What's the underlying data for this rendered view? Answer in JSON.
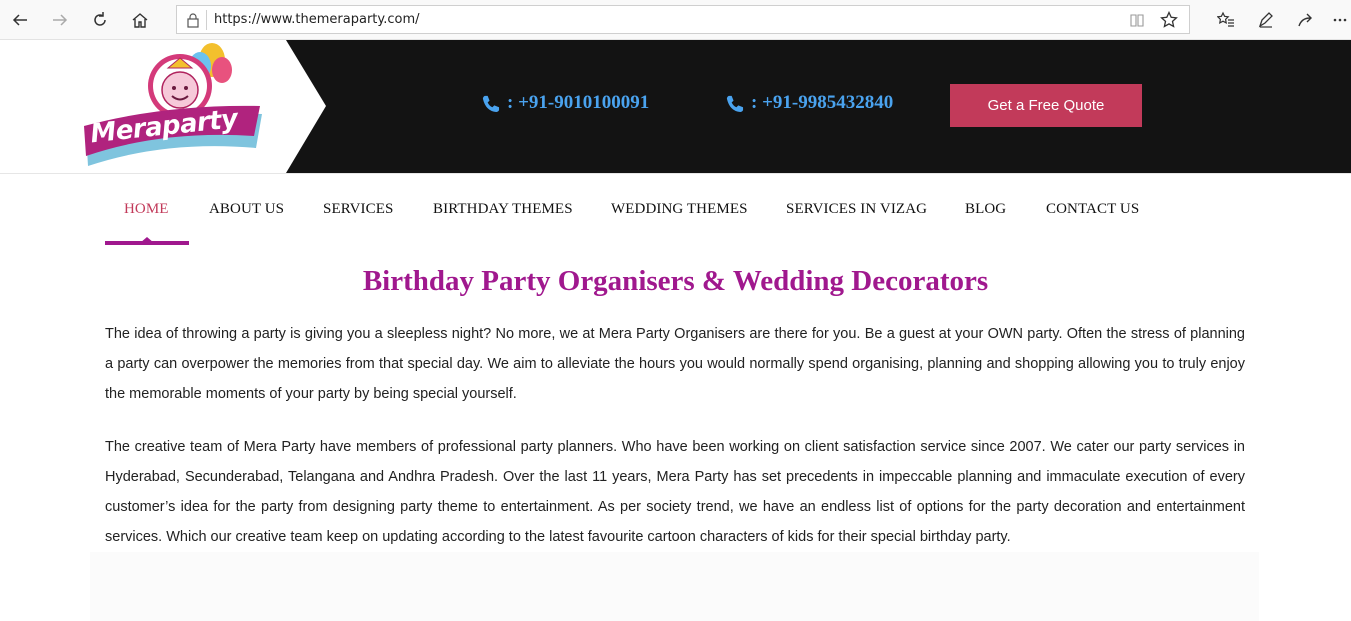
{
  "browser": {
    "url": "https://www.themeraparty.com/"
  },
  "header": {
    "logo_text": "Meraparty",
    "phone_1": ": +91-9010100091",
    "phone_2": ": +91-9985432840",
    "quote_button": "Get a Free Quote",
    "colors": {
      "phone": "#4aa3ef",
      "button": "#c23a5a",
      "background": "#131313"
    }
  },
  "nav": {
    "items": [
      {
        "label": "HOME",
        "active": true
      },
      {
        "label": "ABOUT US"
      },
      {
        "label": "SERVICES"
      },
      {
        "label": "BIRTHDAY THEMES"
      },
      {
        "label": "WEDDING THEMES"
      },
      {
        "label": "SERVICES IN VIZAG"
      },
      {
        "label": "BLOG"
      },
      {
        "label": "CONTACT US"
      }
    ],
    "active_color": "#c23a5a"
  },
  "content": {
    "heading": "Birthday Party Organisers & Wedding Decorators",
    "heading_color": "#a0188e",
    "paragraph_1": "The idea of throwing a party is giving you a sleepless night? No more, we at Mera Party Organisers are there for you. Be a guest at your OWN party. Often the stress of planning a party can overpower the memories from that special day. We aim to alleviate the hours you would normally spend organising, planning and shopping allowing you to truly enjoy the memorable moments of your party by being special yourself.",
    "paragraph_2": "The creative team of Mera Party have members of professional party planners. Who have been working on client satisfaction service since 2007. We cater our party services in Hyderabad, Secunderabad, Telangana and Andhra Pradesh. Over the last 11 years, Mera Party has set precedents in impeccable planning and immaculate execution of every customer’s idea for the party from designing party theme to entertainment. As per society trend, we have an endless list of options for the party decoration and entertainment services. Which our creative team keep on updating according to the latest favourite cartoon characters of kids for their special birthday party."
  }
}
